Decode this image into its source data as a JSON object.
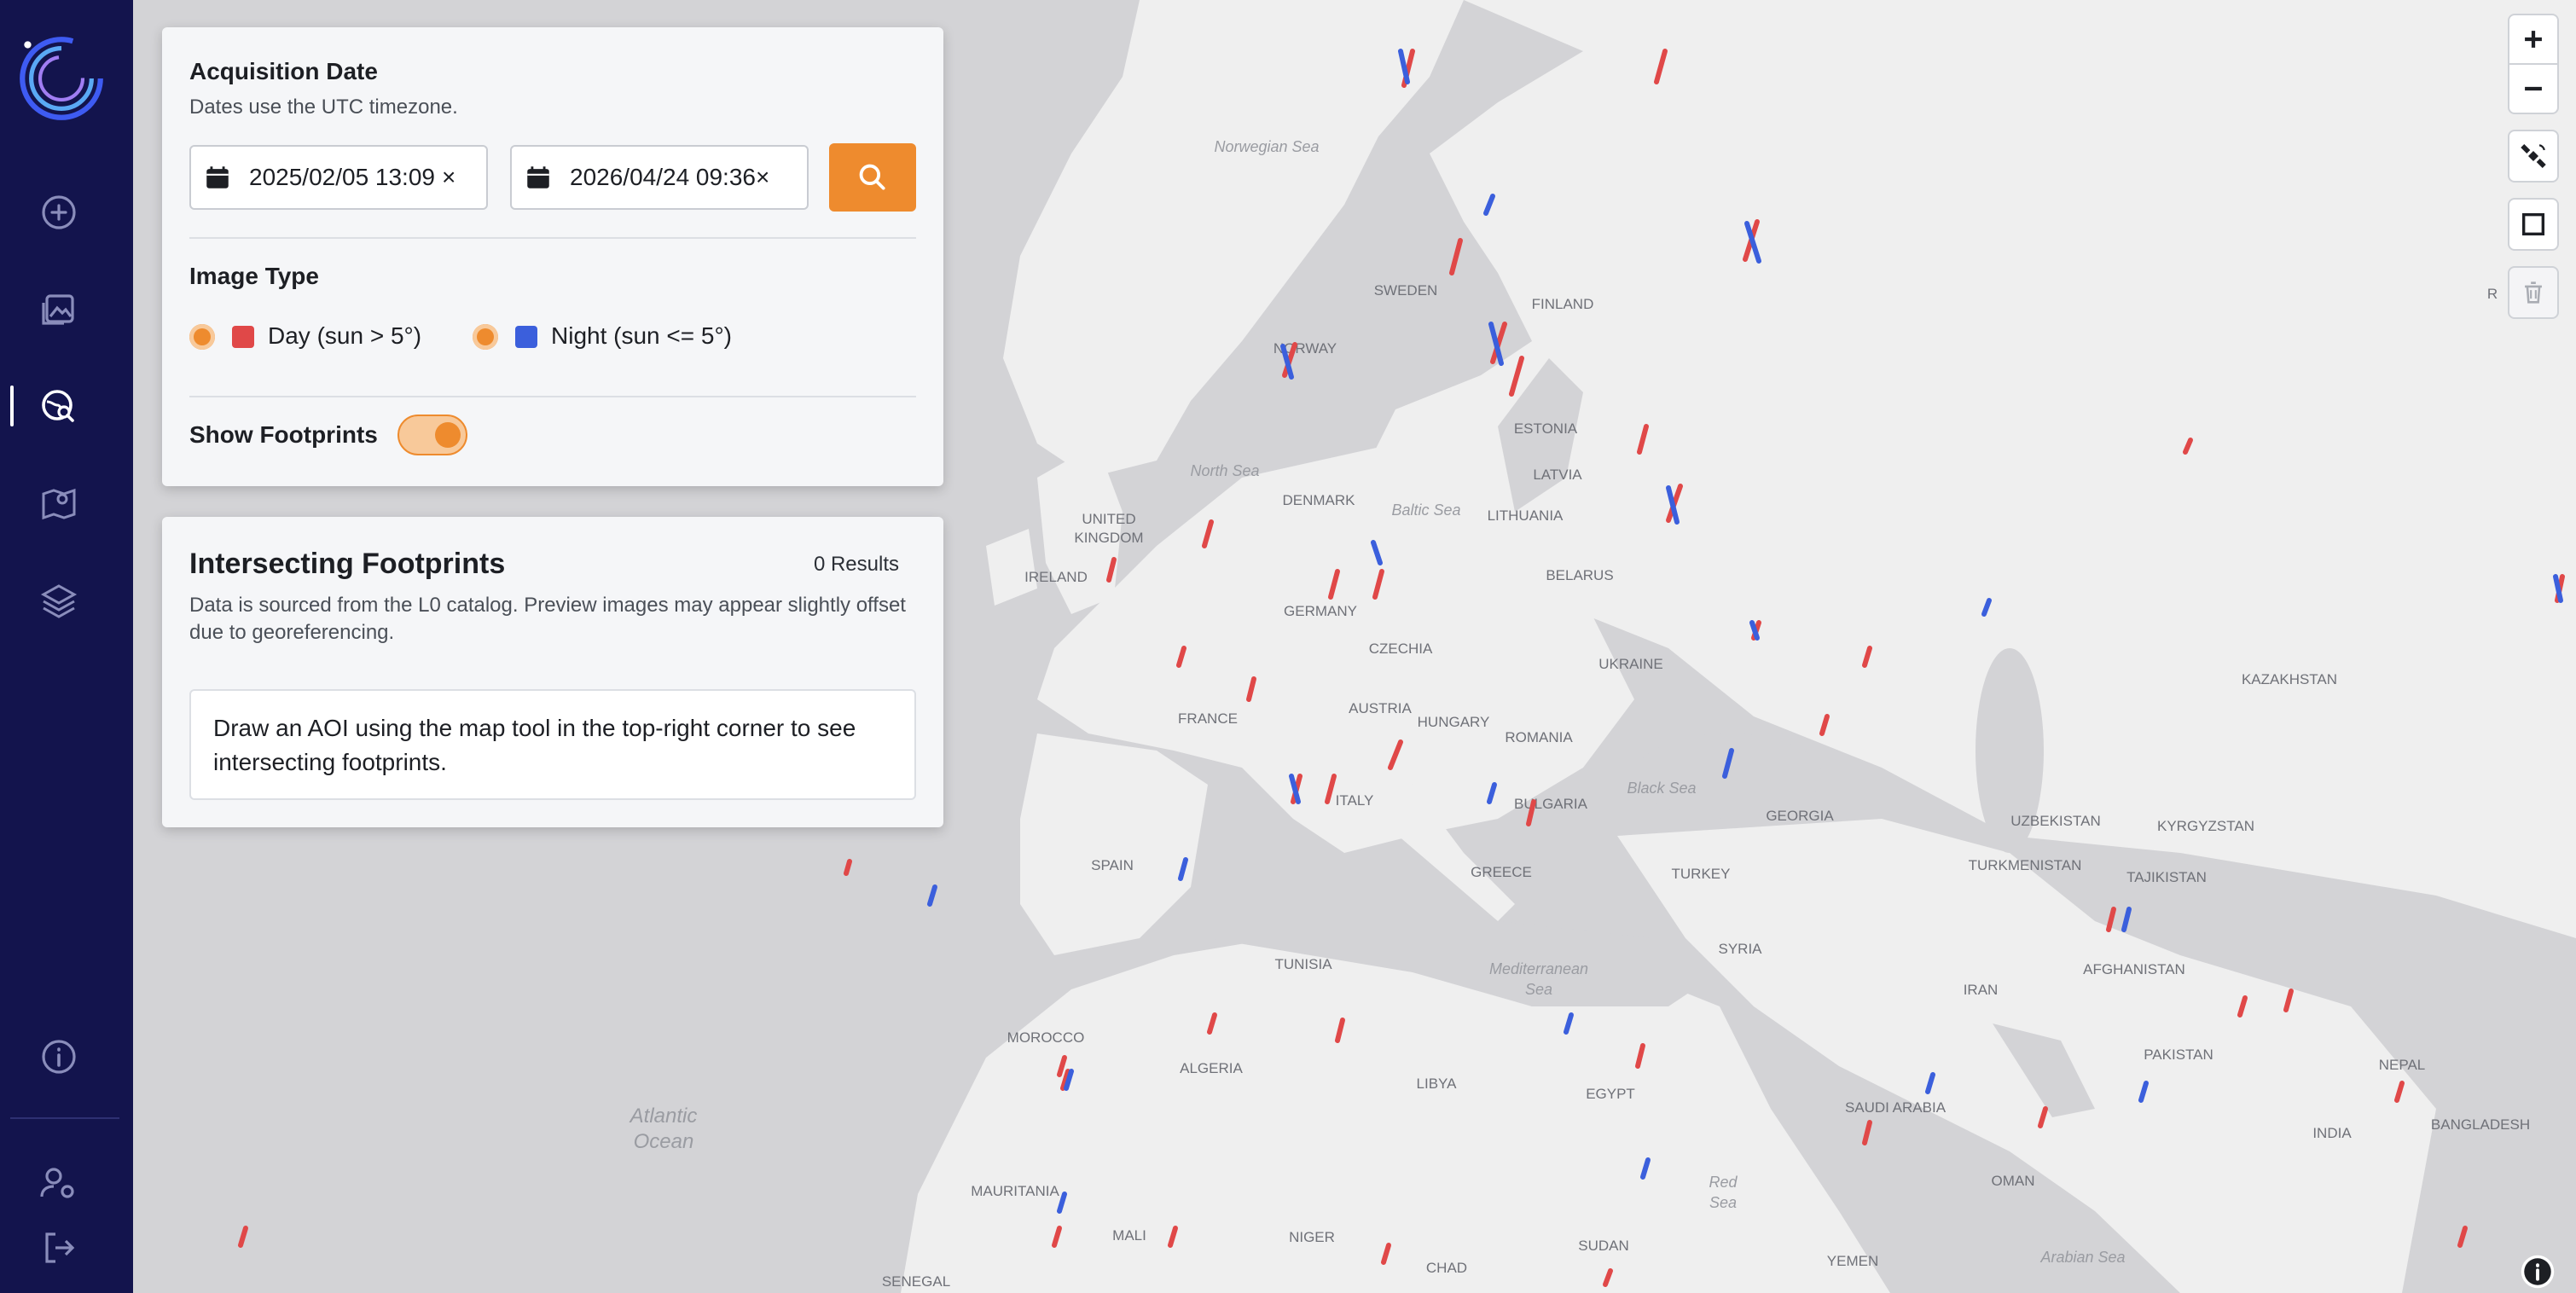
{
  "sidebar": {
    "items": [
      {
        "icon": "plus-circle-icon"
      },
      {
        "icon": "image-icon"
      },
      {
        "icon": "globe-search-icon",
        "active": true
      },
      {
        "icon": "map-pin-icon"
      },
      {
        "icon": "layers-icon"
      }
    ],
    "bottom": [
      {
        "icon": "info-icon"
      },
      {
        "icon": "user-settings-icon"
      },
      {
        "icon": "logout-icon"
      }
    ]
  },
  "acquisition": {
    "title": "Acquisition Date",
    "subtitle": "Dates use the UTC timezone.",
    "start_date": "2025/02/05 13:09",
    "end_date": "2026/04/24 09:36",
    "clear_symbol": "×"
  },
  "image_type": {
    "title": "Image Type",
    "options": [
      {
        "label": "Day (sun > 5°)",
        "color": "#e04848"
      },
      {
        "label": "Night (sun <= 5°)",
        "color": "#3b5fdc"
      }
    ]
  },
  "footprints_toggle": {
    "label": "Show Footprints",
    "on": true
  },
  "intersecting": {
    "title": "Intersecting Footprints",
    "results": "0 Results",
    "description": "Data is sourced from the L0 catalog. Preview images may appear slightly offset due to georeferencing.",
    "hint": "Draw an AOI using the map tool in the top-right corner to see intersecting footprints."
  },
  "map": {
    "seas": [
      {
        "name": "Norwegian Sea"
      },
      {
        "name": "North Sea"
      },
      {
        "name": "Baltic Sea"
      },
      {
        "name": "Black Sea"
      },
      {
        "name": "Mediterranean Sea"
      },
      {
        "name": "Atlantic Ocean"
      },
      {
        "name": "Red Sea"
      },
      {
        "name": "Arabian Sea"
      }
    ],
    "countries": [
      "SWEDEN",
      "FINLAND",
      "NORWAY",
      "ESTONIA",
      "LATVIA",
      "DENMARK",
      "LITHUANIA",
      "UNITED KINGDOM",
      "IRELAND",
      "BELARUS",
      "GERMANY",
      "CZECHIA",
      "UKRAINE",
      "FRANCE",
      "AUSTRIA",
      "HUNGARY",
      "ROMANIA",
      "KAZAKHSTAN",
      "ITALY",
      "BULGARIA",
      "GEORGIA",
      "UZBEKISTAN",
      "KYRGYZSTAN",
      "SPAIN",
      "GREECE",
      "TURKEY",
      "TURKMENISTAN",
      "TAJIKISTAN",
      "TUNISIA",
      "SYRIA",
      "AFGHANISTAN",
      "IRAN",
      "MOROCCO",
      "ALGERIA",
      "LIBYA",
      "EGYPT",
      "SAUDI ARABIA",
      "PAKISTAN",
      "NEPAL",
      "INDIA",
      "BANGLADESH",
      "OMAN",
      "MAURITANIA",
      "MALI",
      "NIGER",
      "CHAD",
      "SUDAN",
      "YEMEN",
      "SENEGAL"
    ],
    "partial_label": "R",
    "colors": {
      "day": "#e04848",
      "night": "#3b5fdc",
      "land": "#efefef",
      "water": "#d3d3d6"
    }
  },
  "map_controls": [
    {
      "name": "zoom-in",
      "icon": "plus-icon"
    },
    {
      "name": "zoom-out",
      "icon": "minus-icon"
    },
    {
      "name": "satellite-tool",
      "icon": "satellite-icon"
    },
    {
      "name": "draw-rectangle",
      "icon": "square-icon"
    },
    {
      "name": "delete-aoi",
      "icon": "trash-icon"
    }
  ]
}
